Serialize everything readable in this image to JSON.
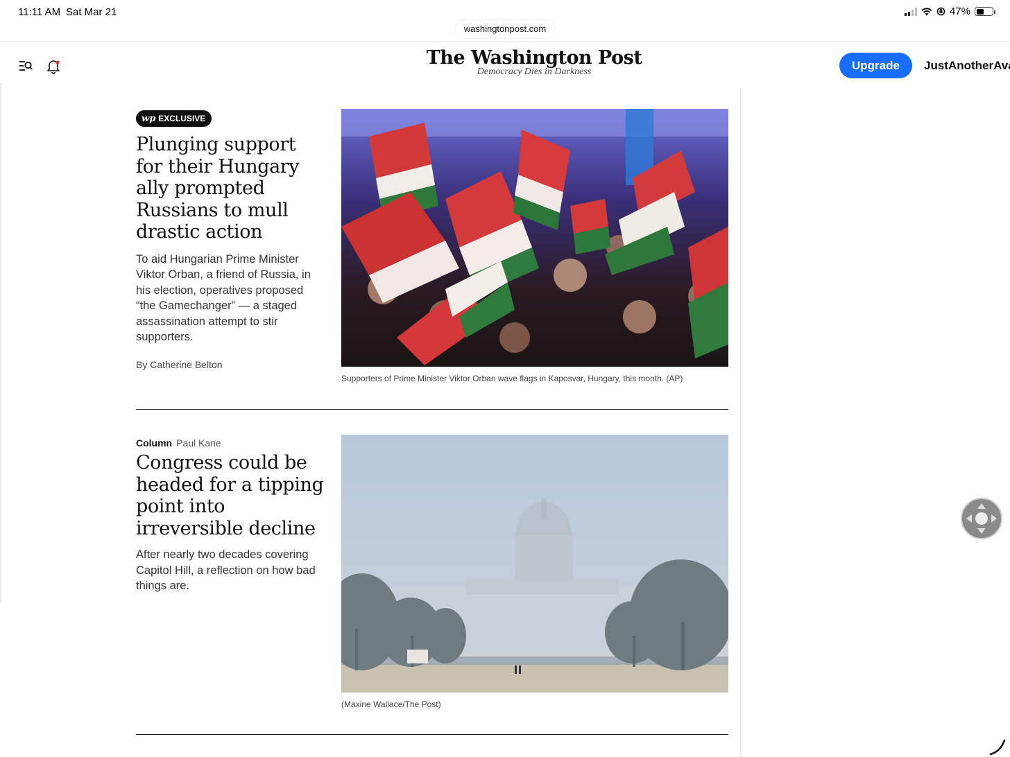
{
  "status_bar": {
    "time": "11:11 AM",
    "date": "Sat Mar 21",
    "battery": "47%",
    "battery_level": 0.47
  },
  "browser": {
    "url": "washingtonpost.com"
  },
  "header": {
    "logo": "The Washington Post",
    "tagline": "Democracy Dies in Darkness",
    "upgrade_label": "Upgrade",
    "account_name": "JustAnotherAva",
    "menu_icon": "menu-search-icon",
    "bell_icon": "bell-icon"
  },
  "articles": [
    {
      "badge_logo": "wp",
      "badge_label": "EXCLUSIVE",
      "headline": "Plunging support for their Hungary ally prompted Russians to mull drastic action",
      "blurb": "To aid Hungarian Prime Minister Viktor Orban, a friend of Russia, in his election, operatives proposed “the Gamechanger” — a staged assassination attempt to stir supporters.",
      "byline": "By Catherine Belton",
      "caption": "Supporters of Prime Minister Viktor Orban wave flags in Kaposvar, Hungary, this month. (AP)"
    },
    {
      "kicker_label": "Column",
      "kicker_author": "Paul Kane",
      "headline": "Congress could be headed for a tipping point into irreversible decline",
      "blurb": "After nearly two decades covering Capitol Hill, a reflection on how bad things are.",
      "caption": "(Maxine Wallace/The Post)"
    }
  ],
  "colors": {
    "accent": "#166dfc",
    "text": "#111111",
    "badge_bg": "#111111"
  }
}
